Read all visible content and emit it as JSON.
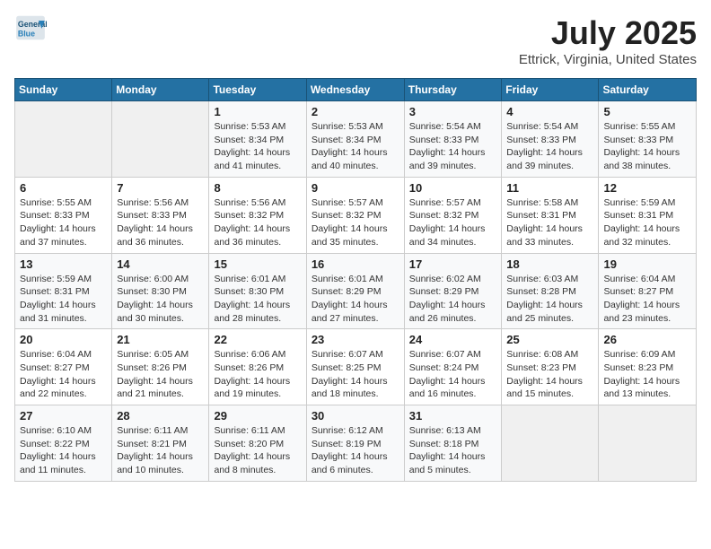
{
  "header": {
    "logo_line1": "General",
    "logo_line2": "Blue",
    "month_year": "July 2025",
    "location": "Ettrick, Virginia, United States"
  },
  "weekdays": [
    "Sunday",
    "Monday",
    "Tuesday",
    "Wednesday",
    "Thursday",
    "Friday",
    "Saturday"
  ],
  "weeks": [
    [
      {
        "day": "",
        "sunrise": "",
        "sunset": "",
        "daylight": ""
      },
      {
        "day": "",
        "sunrise": "",
        "sunset": "",
        "daylight": ""
      },
      {
        "day": "1",
        "sunrise": "Sunrise: 5:53 AM",
        "sunset": "Sunset: 8:34 PM",
        "daylight": "Daylight: 14 hours and 41 minutes."
      },
      {
        "day": "2",
        "sunrise": "Sunrise: 5:53 AM",
        "sunset": "Sunset: 8:34 PM",
        "daylight": "Daylight: 14 hours and 40 minutes."
      },
      {
        "day": "3",
        "sunrise": "Sunrise: 5:54 AM",
        "sunset": "Sunset: 8:33 PM",
        "daylight": "Daylight: 14 hours and 39 minutes."
      },
      {
        "day": "4",
        "sunrise": "Sunrise: 5:54 AM",
        "sunset": "Sunset: 8:33 PM",
        "daylight": "Daylight: 14 hours and 39 minutes."
      },
      {
        "day": "5",
        "sunrise": "Sunrise: 5:55 AM",
        "sunset": "Sunset: 8:33 PM",
        "daylight": "Daylight: 14 hours and 38 minutes."
      }
    ],
    [
      {
        "day": "6",
        "sunrise": "Sunrise: 5:55 AM",
        "sunset": "Sunset: 8:33 PM",
        "daylight": "Daylight: 14 hours and 37 minutes."
      },
      {
        "day": "7",
        "sunrise": "Sunrise: 5:56 AM",
        "sunset": "Sunset: 8:33 PM",
        "daylight": "Daylight: 14 hours and 36 minutes."
      },
      {
        "day": "8",
        "sunrise": "Sunrise: 5:56 AM",
        "sunset": "Sunset: 8:32 PM",
        "daylight": "Daylight: 14 hours and 36 minutes."
      },
      {
        "day": "9",
        "sunrise": "Sunrise: 5:57 AM",
        "sunset": "Sunset: 8:32 PM",
        "daylight": "Daylight: 14 hours and 35 minutes."
      },
      {
        "day": "10",
        "sunrise": "Sunrise: 5:57 AM",
        "sunset": "Sunset: 8:32 PM",
        "daylight": "Daylight: 14 hours and 34 minutes."
      },
      {
        "day": "11",
        "sunrise": "Sunrise: 5:58 AM",
        "sunset": "Sunset: 8:31 PM",
        "daylight": "Daylight: 14 hours and 33 minutes."
      },
      {
        "day": "12",
        "sunrise": "Sunrise: 5:59 AM",
        "sunset": "Sunset: 8:31 PM",
        "daylight": "Daylight: 14 hours and 32 minutes."
      }
    ],
    [
      {
        "day": "13",
        "sunrise": "Sunrise: 5:59 AM",
        "sunset": "Sunset: 8:31 PM",
        "daylight": "Daylight: 14 hours and 31 minutes."
      },
      {
        "day": "14",
        "sunrise": "Sunrise: 6:00 AM",
        "sunset": "Sunset: 8:30 PM",
        "daylight": "Daylight: 14 hours and 30 minutes."
      },
      {
        "day": "15",
        "sunrise": "Sunrise: 6:01 AM",
        "sunset": "Sunset: 8:30 PM",
        "daylight": "Daylight: 14 hours and 28 minutes."
      },
      {
        "day": "16",
        "sunrise": "Sunrise: 6:01 AM",
        "sunset": "Sunset: 8:29 PM",
        "daylight": "Daylight: 14 hours and 27 minutes."
      },
      {
        "day": "17",
        "sunrise": "Sunrise: 6:02 AM",
        "sunset": "Sunset: 8:29 PM",
        "daylight": "Daylight: 14 hours and 26 minutes."
      },
      {
        "day": "18",
        "sunrise": "Sunrise: 6:03 AM",
        "sunset": "Sunset: 8:28 PM",
        "daylight": "Daylight: 14 hours and 25 minutes."
      },
      {
        "day": "19",
        "sunrise": "Sunrise: 6:04 AM",
        "sunset": "Sunset: 8:27 PM",
        "daylight": "Daylight: 14 hours and 23 minutes."
      }
    ],
    [
      {
        "day": "20",
        "sunrise": "Sunrise: 6:04 AM",
        "sunset": "Sunset: 8:27 PM",
        "daylight": "Daylight: 14 hours and 22 minutes."
      },
      {
        "day": "21",
        "sunrise": "Sunrise: 6:05 AM",
        "sunset": "Sunset: 8:26 PM",
        "daylight": "Daylight: 14 hours and 21 minutes."
      },
      {
        "day": "22",
        "sunrise": "Sunrise: 6:06 AM",
        "sunset": "Sunset: 8:26 PM",
        "daylight": "Daylight: 14 hours and 19 minutes."
      },
      {
        "day": "23",
        "sunrise": "Sunrise: 6:07 AM",
        "sunset": "Sunset: 8:25 PM",
        "daylight": "Daylight: 14 hours and 18 minutes."
      },
      {
        "day": "24",
        "sunrise": "Sunrise: 6:07 AM",
        "sunset": "Sunset: 8:24 PM",
        "daylight": "Daylight: 14 hours and 16 minutes."
      },
      {
        "day": "25",
        "sunrise": "Sunrise: 6:08 AM",
        "sunset": "Sunset: 8:23 PM",
        "daylight": "Daylight: 14 hours and 15 minutes."
      },
      {
        "day": "26",
        "sunrise": "Sunrise: 6:09 AM",
        "sunset": "Sunset: 8:23 PM",
        "daylight": "Daylight: 14 hours and 13 minutes."
      }
    ],
    [
      {
        "day": "27",
        "sunrise": "Sunrise: 6:10 AM",
        "sunset": "Sunset: 8:22 PM",
        "daylight": "Daylight: 14 hours and 11 minutes."
      },
      {
        "day": "28",
        "sunrise": "Sunrise: 6:11 AM",
        "sunset": "Sunset: 8:21 PM",
        "daylight": "Daylight: 14 hours and 10 minutes."
      },
      {
        "day": "29",
        "sunrise": "Sunrise: 6:11 AM",
        "sunset": "Sunset: 8:20 PM",
        "daylight": "Daylight: 14 hours and 8 minutes."
      },
      {
        "day": "30",
        "sunrise": "Sunrise: 6:12 AM",
        "sunset": "Sunset: 8:19 PM",
        "daylight": "Daylight: 14 hours and 6 minutes."
      },
      {
        "day": "31",
        "sunrise": "Sunrise: 6:13 AM",
        "sunset": "Sunset: 8:18 PM",
        "daylight": "Daylight: 14 hours and 5 minutes."
      },
      {
        "day": "",
        "sunrise": "",
        "sunset": "",
        "daylight": ""
      },
      {
        "day": "",
        "sunrise": "",
        "sunset": "",
        "daylight": ""
      }
    ]
  ]
}
